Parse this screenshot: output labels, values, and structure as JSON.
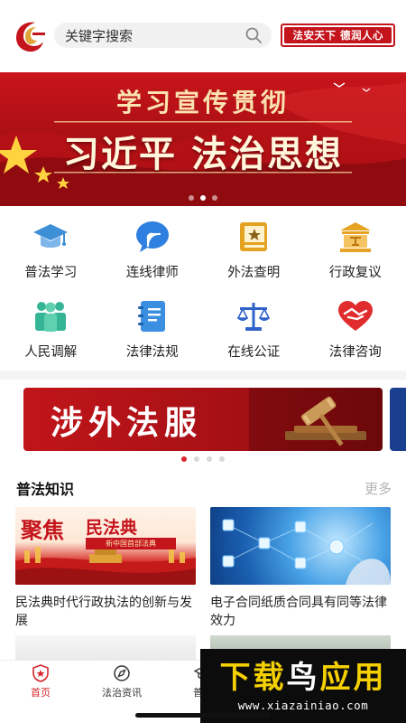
{
  "search": {
    "placeholder": "关键字搜索",
    "icon": "search-icon"
  },
  "header": {
    "slogan": "法安天下 德润人心",
    "brand_color": "#c4141c"
  },
  "banner": {
    "line1": "学习宣传贯彻",
    "line2": "习近平 法治思想",
    "active_index": 1,
    "count": 3
  },
  "grid": [
    {
      "label": "普法学习",
      "icon": "graduation-cap-icon",
      "color": "#3d8fd6"
    },
    {
      "label": "连线律师",
      "icon": "chat-bubble-icon",
      "color": "#2f7fe0"
    },
    {
      "label": "外法查明",
      "icon": "book-star-icon",
      "color": "#e3a320"
    },
    {
      "label": "行政复议",
      "icon": "courthouse-icon",
      "color": "#e7a323"
    },
    {
      "label": "人民调解",
      "icon": "people-icon",
      "color": "#36b596"
    },
    {
      "label": "法律法规",
      "icon": "notebook-icon",
      "color": "#3a8fe0"
    },
    {
      "label": "在线公证",
      "icon": "scales-icon",
      "color": "#2f62c9"
    },
    {
      "label": "法律咨询",
      "icon": "heart-handshake-icon",
      "color": "#e02c2c"
    }
  ],
  "banner2": {
    "title": "涉外法服",
    "active_index": 0,
    "count": 4
  },
  "section": {
    "title": "普法知识",
    "more": "更多"
  },
  "articles": [
    {
      "title": "民法典时代行政执法的创新与发展",
      "thumb_text_1": "聚焦",
      "thumb_text_2": "民法典",
      "thumb_text_3": "新中国首部法典"
    },
    {
      "title": "电子合同纸质合同具有同等法律效力"
    }
  ],
  "nav": [
    {
      "label": "首页",
      "icon": "home-shield-icon",
      "active": true
    },
    {
      "label": "法治资讯",
      "icon": "compass-icon",
      "active": false
    },
    {
      "label": "普法",
      "icon": "graduation-cap-icon",
      "active": false
    }
  ],
  "watermark": {
    "line1_a": "下载",
    "line1_b": "鸟",
    "line1_c": "应用",
    "line2": "www.xiazainiao.com"
  }
}
